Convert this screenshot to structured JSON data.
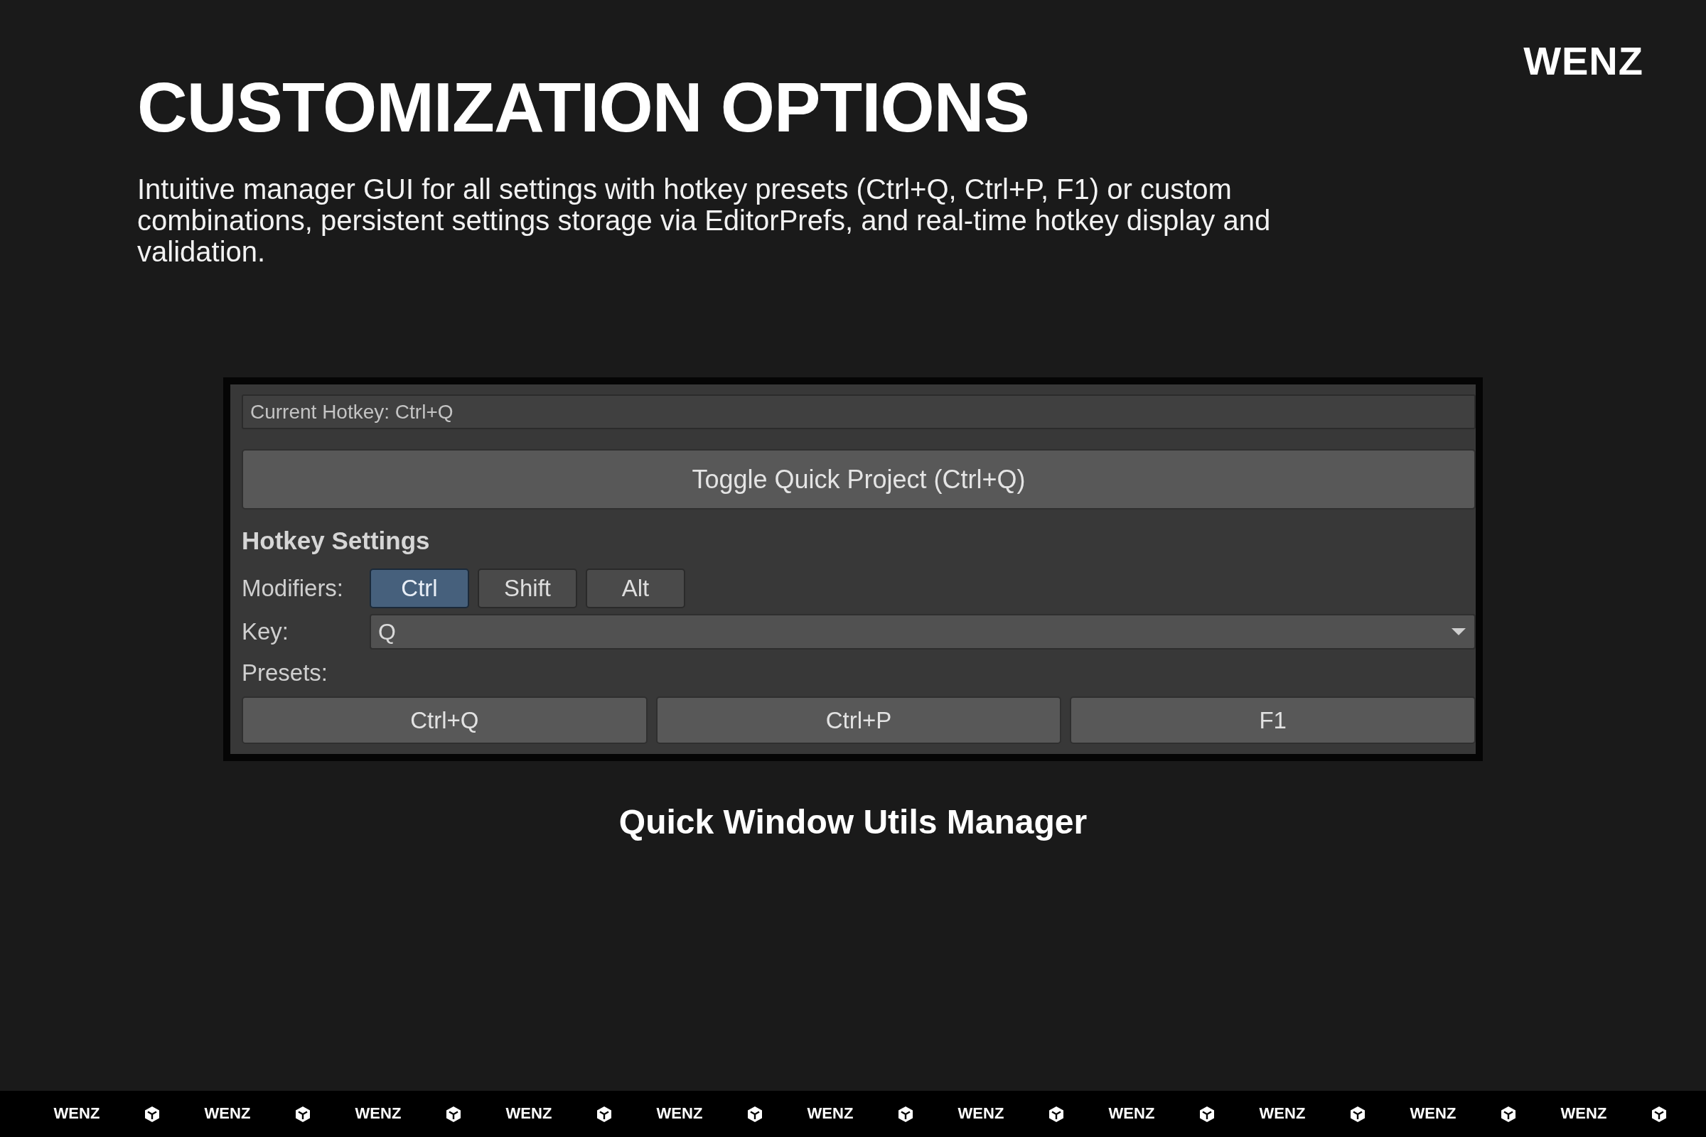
{
  "brand": "WENZ",
  "title": "CUSTOMIZATION OPTIONS",
  "description": "Intuitive manager GUI for all settings with hotkey presets (Ctrl+Q, Ctrl+P, F1) or custom combinations, persistent settings storage via EditorPrefs, and real-time hotkey display and validation.",
  "panel": {
    "current_hotkey": "Current Hotkey: Ctrl+Q",
    "toggle_button": "Toggle Quick Project (Ctrl+Q)",
    "section_title": "Hotkey Settings",
    "modifiers_label": "Modifiers:",
    "modifiers": [
      {
        "label": "Ctrl",
        "selected": true
      },
      {
        "label": "Shift",
        "selected": false
      },
      {
        "label": "Alt",
        "selected": false
      }
    ],
    "key_label": "Key:",
    "key_value": "Q",
    "presets_label": "Presets:",
    "presets": [
      "Ctrl+Q",
      "Ctrl+P",
      "F1"
    ]
  },
  "caption": "Quick Window Utils Manager",
  "footer_strip": [
    {
      "kind": "logo",
      "text": "WENZ"
    },
    {
      "kind": "icon"
    },
    {
      "kind": "logo",
      "text": "WENZ"
    },
    {
      "kind": "icon"
    },
    {
      "kind": "logo",
      "text": "WENZ"
    },
    {
      "kind": "icon"
    },
    {
      "kind": "logo",
      "text": "WENZ"
    },
    {
      "kind": "icon"
    },
    {
      "kind": "logo",
      "text": "WENZ"
    },
    {
      "kind": "icon"
    },
    {
      "kind": "logo",
      "text": "WENZ"
    },
    {
      "kind": "icon"
    },
    {
      "kind": "logo",
      "text": "WENZ"
    },
    {
      "kind": "icon"
    },
    {
      "kind": "logo",
      "text": "WENZ"
    },
    {
      "kind": "icon"
    },
    {
      "kind": "logo",
      "text": "WENZ"
    },
    {
      "kind": "icon"
    },
    {
      "kind": "logo",
      "text": "WENZ"
    },
    {
      "kind": "icon"
    },
    {
      "kind": "logo",
      "text": "WENZ"
    },
    {
      "kind": "icon"
    }
  ]
}
